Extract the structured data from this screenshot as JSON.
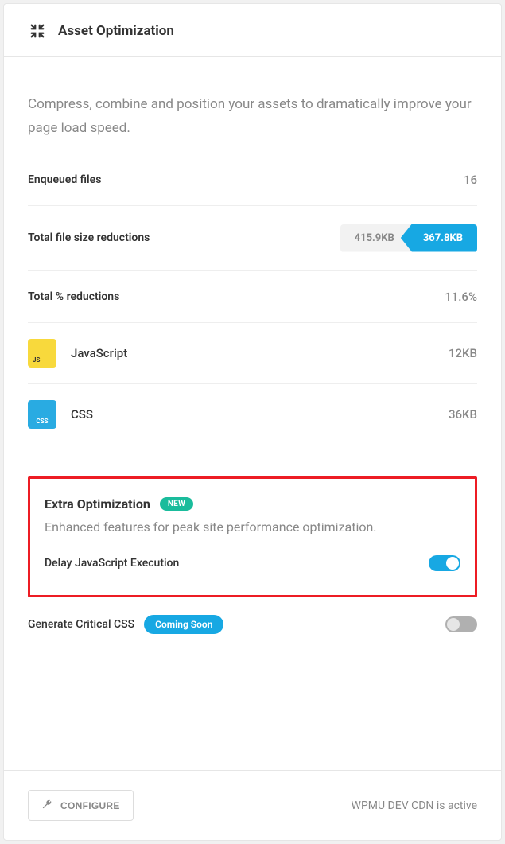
{
  "header": {
    "title": "Asset Optimization"
  },
  "intro": "Compress, combine and position your assets to dramatically improve your page load speed.",
  "stats": {
    "enqueued": {
      "label": "Enqueued files",
      "value": "16"
    },
    "filesize": {
      "label": "Total file size reductions",
      "original": "415.9KB",
      "reduced": "367.8KB"
    },
    "percent": {
      "label": "Total % reductions",
      "value": "11.6%"
    }
  },
  "assets": {
    "js": {
      "name": "JavaScript",
      "value": "12KB",
      "badge": "JS"
    },
    "css": {
      "name": "CSS",
      "value": "36KB",
      "badge": "CSS"
    }
  },
  "extra": {
    "title": "Extra Optimization",
    "badge": "NEW",
    "description": "Enhanced features for peak site performance optimization.",
    "delay_js": {
      "label": "Delay JavaScript Execution",
      "enabled": true
    }
  },
  "critical_css": {
    "label": "Generate Critical CSS",
    "badge": "Coming Soon",
    "enabled": false
  },
  "footer": {
    "configure": "CONFIGURE",
    "status": "WPMU DEV CDN is active"
  }
}
